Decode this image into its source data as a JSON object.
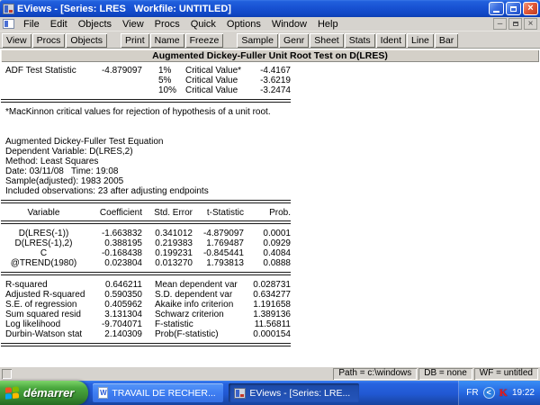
{
  "window": {
    "title": "EViews - [Series: LRES   Workfile: UNTITLED]"
  },
  "menu_items": [
    "File",
    "Edit",
    "Objects",
    "View",
    "Procs",
    "Quick",
    "Options",
    "Window",
    "Help"
  ],
  "toolbar_groups": [
    [
      "View",
      "Procs",
      "Objects"
    ],
    [
      "Print",
      "Name",
      "Freeze"
    ],
    [
      "Sample",
      "Genr",
      "Sheet",
      "Stats",
      "Ident",
      "Line",
      "Bar"
    ]
  ],
  "report": {
    "header": "Augmented Dickey-Fuller Unit Root Test on D(LRES)",
    "adf_label": "ADF Test Statistic",
    "adf_value": "-4.879097",
    "critical_values": [
      {
        "pct": "1%",
        "label": "Critical Value*",
        "value": "-4.4167"
      },
      {
        "pct": "5%",
        "label": "Critical Value",
        "value": "-3.6219"
      },
      {
        "pct": "10%",
        "label": "Critical Value",
        "value": "-3.2474"
      }
    ],
    "note": "*MacKinnon critical values for rejection of hypothesis of a unit root.",
    "equation_info": [
      "Augmented Dickey-Fuller Test Equation",
      "Dependent Variable: D(LRES,2)",
      "Method: Least Squares",
      "Date: 03/11/08   Time: 19:08",
      "Sample(adjusted): 1983 2005",
      "Included observations: 23 after adjusting endpoints"
    ],
    "coef_table": {
      "headers": [
        "Variable",
        "Coefficient",
        "Std. Error",
        "t-Statistic",
        "Prob."
      ],
      "rows": [
        [
          "D(LRES(-1))",
          "-1.663832",
          "0.341012",
          "-4.879097",
          "0.0001"
        ],
        [
          "D(LRES(-1),2)",
          "0.388195",
          "0.219383",
          "1.769487",
          "0.0929"
        ],
        [
          "C",
          "-0.168438",
          "0.199231",
          "-0.845441",
          "0.4084"
        ],
        [
          "@TREND(1980)",
          "0.023804",
          "0.013270",
          "1.793813",
          "0.0888"
        ]
      ]
    },
    "stats": [
      [
        "R-squared",
        "0.646211",
        "Mean dependent var",
        "0.028731"
      ],
      [
        "Adjusted R-squared",
        "0.590350",
        "S.D. dependent var",
        "0.634277"
      ],
      [
        "S.E. of regression",
        "0.405962",
        "Akaike info criterion",
        "1.191658"
      ],
      [
        "Sum squared resid",
        "3.131304",
        "Schwarz criterion",
        "1.389136"
      ],
      [
        "Log likelihood",
        "-9.704071",
        "F-statistic",
        "11.56811"
      ],
      [
        "Durbin-Watson stat",
        "2.140309",
        "Prob(F-statistic)",
        "0.000154"
      ]
    ]
  },
  "status_bar": {
    "panels": [
      "Path = c:\\windows",
      "DB = none",
      "WF = untitled"
    ]
  },
  "taskbar": {
    "start_label": "démarrer",
    "tasks": [
      {
        "label": "TRAVAIL DE RECHER..."
      },
      {
        "label": "EViews - [Series: LRE..."
      }
    ],
    "tray": {
      "lang": "FR",
      "time": "19:22"
    }
  },
  "icons": {
    "word_glyph": "W",
    "kaspersky_glyph": "K",
    "tray_chevron_glyph": "<",
    "close_glyph": "×",
    "mdi_min_glyph": "–",
    "mdi_close_glyph": "×"
  },
  "colors": {
    "titlebar_blue": "#1953d4",
    "taskbar_blue": "#2158d2",
    "start_green": "#4aa83e",
    "close_red": "#e25a3a",
    "chrome_gray": "#d6d3ce",
    "kaspersky_red": "#e81c1c"
  }
}
